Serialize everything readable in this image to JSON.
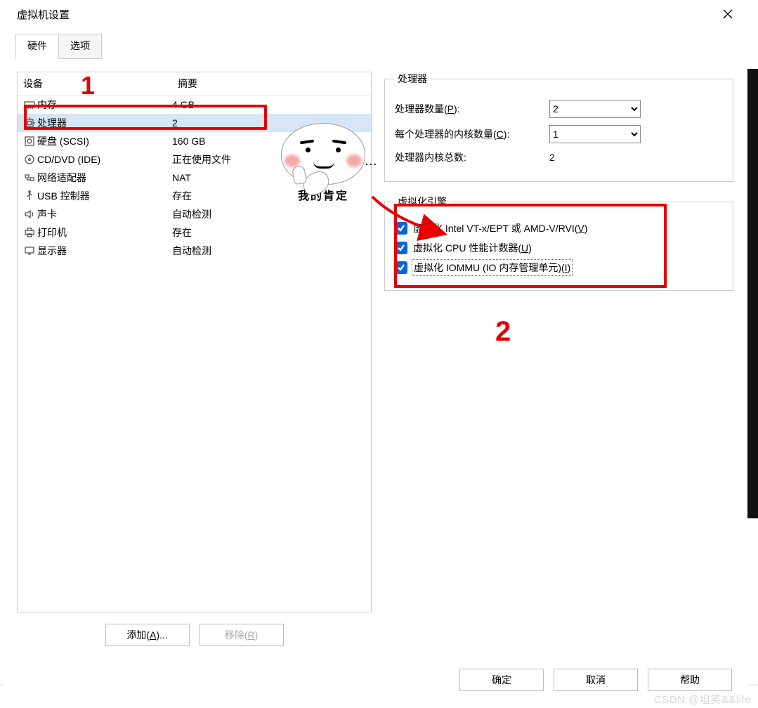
{
  "window": {
    "title": "虚拟机设置"
  },
  "tabs": {
    "hardware": "硬件",
    "options": "选项"
  },
  "table": {
    "headers": {
      "device": "设备",
      "summary": "摘要"
    },
    "rows": [
      {
        "device": "内存",
        "summary": "4 GB",
        "icon": "memory"
      },
      {
        "device": "处理器",
        "summary": "2",
        "icon": "cpu",
        "selected": true
      },
      {
        "device": "硬盘 (SCSI)",
        "summary": "160 GB",
        "icon": "disk"
      },
      {
        "device": "CD/DVD (IDE)",
        "summary": "正在使用文件",
        "icon": "cd"
      },
      {
        "device": "网络适配器",
        "summary": "NAT",
        "icon": "net"
      },
      {
        "device": "USB 控制器",
        "summary": "存在",
        "icon": "usb"
      },
      {
        "device": "声卡",
        "summary": "自动检测",
        "icon": "sound"
      },
      {
        "device": "打印机",
        "summary": "存在",
        "icon": "printer"
      },
      {
        "device": "显示器",
        "summary": "自动检测",
        "icon": "display"
      }
    ]
  },
  "left_buttons": {
    "add": "添加(",
    "add_mn": "A",
    "add_tail": ")...",
    "remove": "移除(",
    "remove_mn": "R",
    "remove_tail": ")"
  },
  "proc_group": {
    "legend": "处理器",
    "count_label_pre": "处理器数量(",
    "count_mn": "P",
    "count_label_post": "):",
    "count_value": "2",
    "cores_label_pre": "每个处理器的内核数量(",
    "cores_mn": "C",
    "cores_label_post": "):",
    "cores_value": "1",
    "total_label": "处理器内核总数:",
    "total_value": "2"
  },
  "virt_group": {
    "legend": "虚拟化引擎",
    "vt_pre": "虚拟化 Intel VT-x/EPT 或 AMD-V/RVI(",
    "vt_mn": "V",
    "vt_post": ")",
    "cpu_pre": "虚拟化 CPU 性能计数器(",
    "cpu_mn": "U",
    "cpu_post": ")",
    "iommu_pre": "虚拟化 IOMMU (IO 内存管理单元)(",
    "iommu_mn": "I",
    "iommu_post": ")"
  },
  "footer": {
    "ok": "确定",
    "cancel": "取消",
    "help": "帮助"
  },
  "annotations": {
    "one": "1",
    "two": "2",
    "meme_caption": "我的肯定",
    "dots": "..."
  },
  "watermark": "CSDN @坦笑&&life"
}
